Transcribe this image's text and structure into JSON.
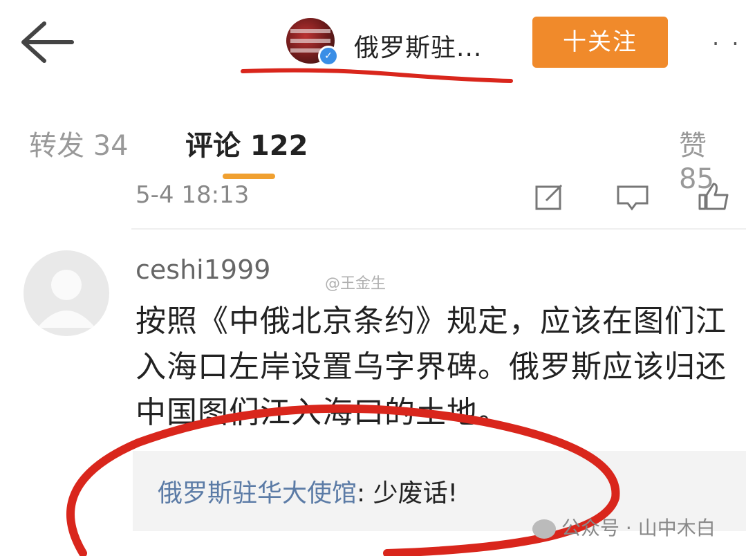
{
  "header": {
    "back_icon": "arrow-left-icon",
    "account_name": "俄罗斯驻...",
    "follow_label": "十关注",
    "more_label": "· ·"
  },
  "tabs": {
    "repost": "转发 34",
    "comments": "评论 122",
    "likes": "赞 85"
  },
  "prev_comment": {
    "timestamp": "5-4 18:13"
  },
  "comment": {
    "username": "ceshi1999",
    "text": "按照《中俄北京条约》规定，应该在图们江入海口左岸设置乌字界碑。俄罗斯应该归还中国图们江入海口的土地。",
    "reply_author": "俄罗斯驻华大使馆",
    "reply_text": ": 少废话!"
  },
  "watermarks": {
    "top": "@王金生",
    "bottom": "公众号 · 山中木白"
  },
  "colors": {
    "follow_button": "#f08a2b",
    "tab_indicator": "#f0a030",
    "annotation_red": "#d9261c",
    "reply_author": "#5b7ba6"
  }
}
